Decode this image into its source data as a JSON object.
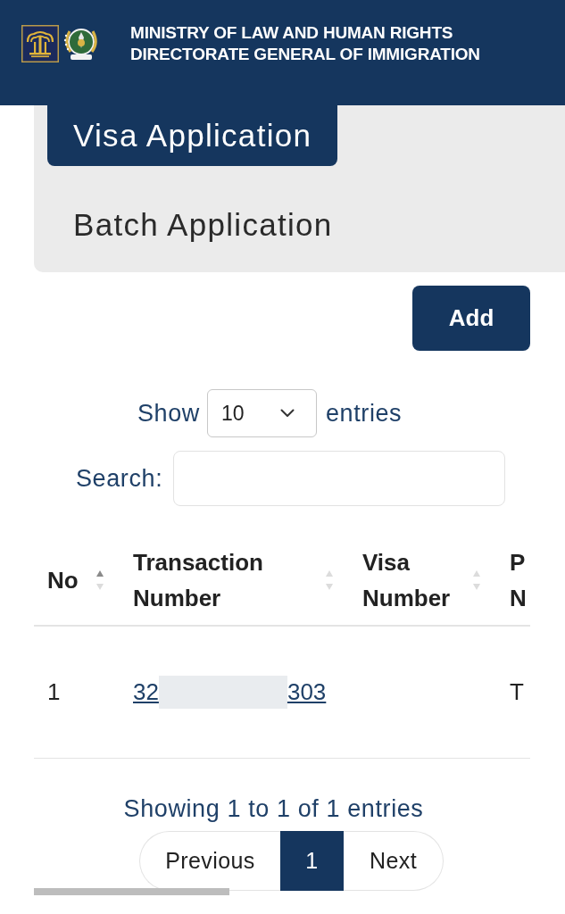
{
  "header": {
    "lines": [
      "MINISTRY OF LAW AND HUMAN RIGHTS",
      "DIRECTORATE GENERAL OF IMMIGRATION"
    ]
  },
  "panel": {
    "tabs": [
      {
        "label": "Visa Application",
        "selected": true
      },
      {
        "label": "Batch Application",
        "selected": false
      }
    ]
  },
  "add_button": {
    "label": "Add"
  },
  "length_control": {
    "prefix": "Show",
    "value": "10",
    "suffix": "entries"
  },
  "search": {
    "label": "Search:"
  },
  "table": {
    "columns": [
      {
        "label": "No",
        "sorted": true
      },
      {
        "label": "Transaction Number",
        "sorted": false
      },
      {
        "label": "Visa Number",
        "sorted": false
      },
      {
        "label": "P N"
      }
    ],
    "rows": [
      {
        "no": "1",
        "transaction_number": {
          "start": "32",
          "end": "303",
          "redacted": true
        },
        "column_4": "T"
      }
    ]
  },
  "info": "Showing 1 to 1 of 1 entries",
  "pagination": [
    {
      "kind": "previous",
      "label": "Previous",
      "selected": false
    },
    {
      "kind": "page",
      "label": "1",
      "selected": true
    },
    {
      "kind": "next",
      "label": "Next",
      "selected": false
    }
  ]
}
